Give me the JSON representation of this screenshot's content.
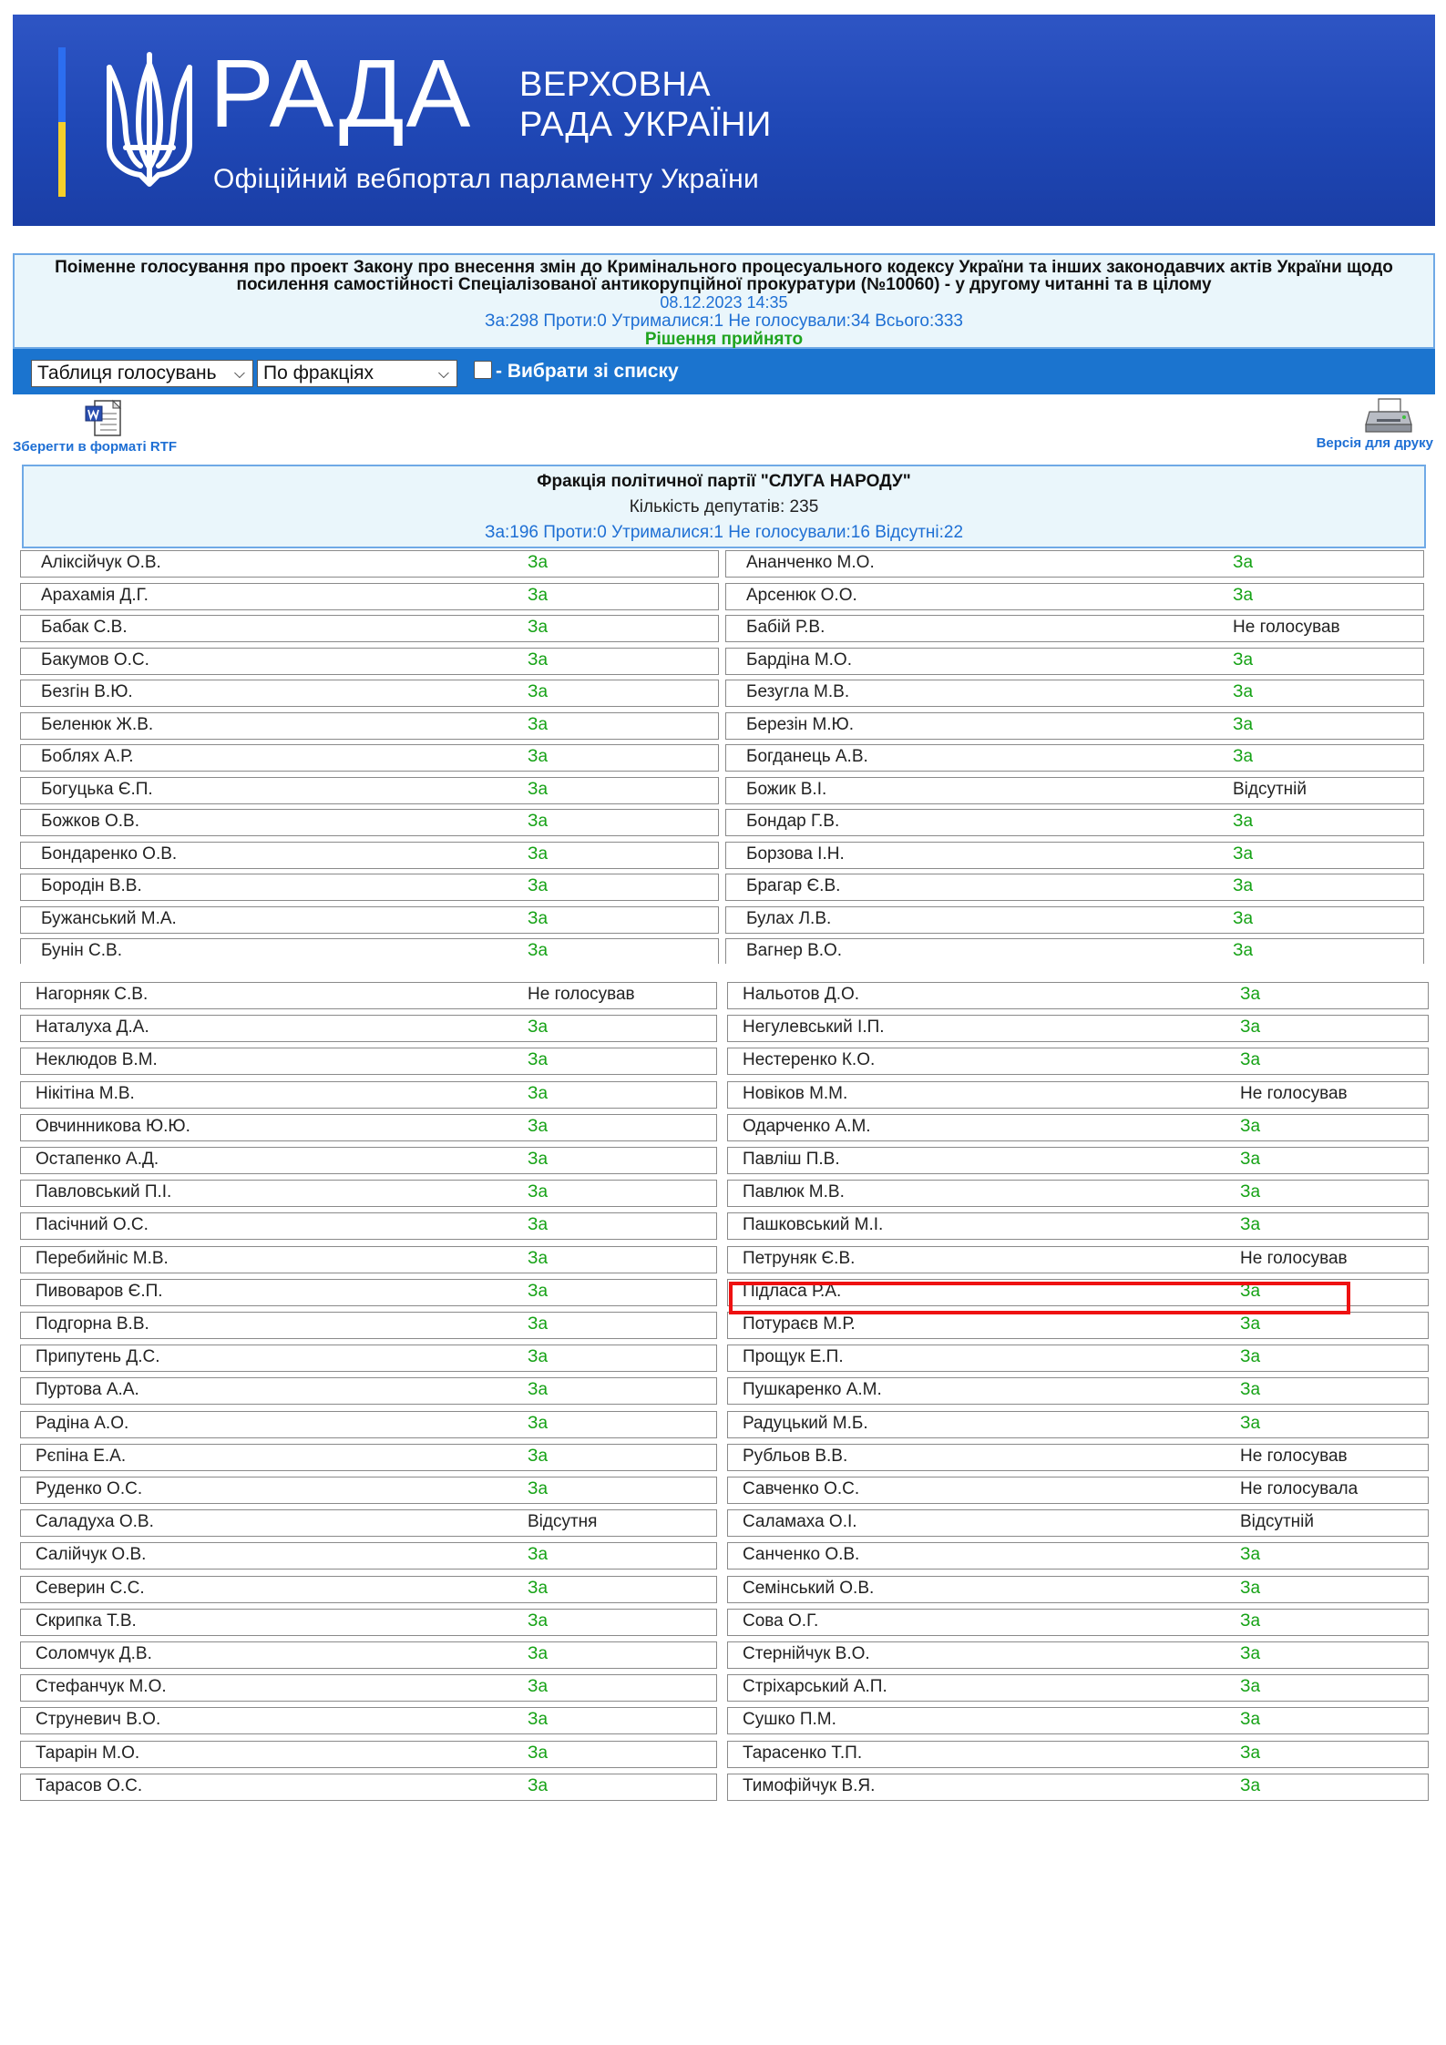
{
  "header": {
    "logo_word": "РАДА",
    "logo_line1": "ВЕРХОВНА",
    "logo_line2": "РАДА УКРАЇНИ",
    "tagline": "Офіційний вебпортал парламенту України",
    "colors": {
      "banner": "#2450bf",
      "flag_blue": "#2c6ef0",
      "flag_yellow": "#f5cf2b"
    }
  },
  "vote": {
    "title": "Поіменне голосування про проект Закону про внесення змін до Кримінального процесуального кодексу України та інших законодавчих актів України щодо посилення самостійності Спеціалізованої антикорупційної прокуратури (№10060) - у другому читанні та в цілому",
    "datetime": "08.12.2023 14:35",
    "totals": "За:298 Проти:0 Утрималися:1 Не голосували:34 Всього:333",
    "decision": "Рішення прийнято"
  },
  "toolbar": {
    "view_select": "Таблиця голосувань",
    "group_select": "По фракціях",
    "pick_label": "- Вибрати зі списку"
  },
  "links": {
    "rtf": "Зберегти в форматі RTF",
    "print": "Версія для друку"
  },
  "faction": {
    "name": "Фракція політичної партії \"СЛУГА НАРОДУ\"",
    "count": "Кількість депутатів: 235",
    "stats": "За:196 Проти:0 Утрималися:1 Не голосували:16 Відсутні:22"
  },
  "table1": [
    [
      [
        "Аліксійчук О.В.",
        "За"
      ],
      [
        "Ананченко М.О.",
        "За"
      ]
    ],
    [
      [
        "Арахамія Д.Г.",
        "За"
      ],
      [
        "Арсенюк О.О.",
        "За"
      ]
    ],
    [
      [
        "Бабак С.В.",
        "За"
      ],
      [
        "Бабій Р.В.",
        "Не голосував"
      ]
    ],
    [
      [
        "Бакумов О.С.",
        "За"
      ],
      [
        "Бардіна М.О.",
        "За"
      ]
    ],
    [
      [
        "Безгін В.Ю.",
        "За"
      ],
      [
        "Безугла М.В.",
        "За"
      ]
    ],
    [
      [
        "Беленюк Ж.В.",
        "За"
      ],
      [
        "Березін М.Ю.",
        "За"
      ]
    ],
    [
      [
        "Боблях А.Р.",
        "За"
      ],
      [
        "Богданець А.В.",
        "За"
      ]
    ],
    [
      [
        "Богуцька Є.П.",
        "За"
      ],
      [
        "Божик В.І.",
        "Відсутній"
      ]
    ],
    [
      [
        "Божков О.В.",
        "За"
      ],
      [
        "Бондар Г.В.",
        "За"
      ]
    ],
    [
      [
        "Бондаренко О.В.",
        "За"
      ],
      [
        "Борзова І.Н.",
        "За"
      ]
    ],
    [
      [
        "Бородін В.В.",
        "За"
      ],
      [
        "Брагар Є.В.",
        "За"
      ]
    ],
    [
      [
        "Бужанський М.А.",
        "За"
      ],
      [
        "Булах Л.В.",
        "За"
      ]
    ],
    [
      [
        "Бунін С.В.",
        "За"
      ],
      [
        "Вагнер В.О.",
        "За"
      ]
    ]
  ],
  "table2": [
    [
      [
        "Нагорняк С.В.",
        "Не голосував"
      ],
      [
        "Нальотов Д.О.",
        "За"
      ]
    ],
    [
      [
        "Наталуха Д.А.",
        "За"
      ],
      [
        "Негулевський І.П.",
        "За"
      ]
    ],
    [
      [
        "Неклюдов В.М.",
        "За"
      ],
      [
        "Нестеренко К.О.",
        "За"
      ]
    ],
    [
      [
        "Нікітіна М.В.",
        "За"
      ],
      [
        "Новіков М.М.",
        "Не голосував"
      ]
    ],
    [
      [
        "Овчинникова Ю.Ю.",
        "За"
      ],
      [
        "Одарченко А.М.",
        "За"
      ]
    ],
    [
      [
        "Остапенко А.Д.",
        "За"
      ],
      [
        "Павліш П.В.",
        "За"
      ]
    ],
    [
      [
        "Павловський П.І.",
        "За"
      ],
      [
        "Павлюк М.В.",
        "За"
      ]
    ],
    [
      [
        "Пасічний О.С.",
        "За"
      ],
      [
        "Пашковський М.І.",
        "За"
      ]
    ],
    [
      [
        "Перебийніс М.В.",
        "За"
      ],
      [
        "Петруняк Є.В.",
        "Не голосував"
      ]
    ],
    [
      [
        "Пивоваров Є.П.",
        "За"
      ],
      [
        "Підласа Р.А.",
        "За"
      ]
    ],
    [
      [
        "Подгорна В.В.",
        "За"
      ],
      [
        "Потураєв М.Р.",
        "За"
      ]
    ],
    [
      [
        "Припутень Д.С.",
        "За"
      ],
      [
        "Прощук Е.П.",
        "За"
      ]
    ],
    [
      [
        "Пуртова А.А.",
        "За"
      ],
      [
        "Пушкаренко А.М.",
        "За"
      ]
    ],
    [
      [
        "Радіна А.О.",
        "За"
      ],
      [
        "Радуцький М.Б.",
        "За"
      ]
    ],
    [
      [
        "Рєпіна Е.А.",
        "За"
      ],
      [
        "Рубльов В.В.",
        "Не голосував"
      ]
    ],
    [
      [
        "Руденко О.С.",
        "За"
      ],
      [
        "Савченко О.С.",
        "Не голосувала"
      ]
    ],
    [
      [
        "Саладуха О.В.",
        "Відсутня"
      ],
      [
        "Саламаха О.І.",
        "Відсутній"
      ]
    ],
    [
      [
        "Салійчук О.В.",
        "За"
      ],
      [
        "Санченко О.В.",
        "За"
      ]
    ],
    [
      [
        "Северин С.С.",
        "За"
      ],
      [
        "Семінський О.В.",
        "За"
      ]
    ],
    [
      [
        "Скрипка Т.В.",
        "За"
      ],
      [
        "Сова О.Г.",
        "За"
      ]
    ],
    [
      [
        "Соломчук Д.В.",
        "За"
      ],
      [
        "Стернійчук В.О.",
        "За"
      ]
    ],
    [
      [
        "Стефанчук М.О.",
        "За"
      ],
      [
        "Стріхарський А.П.",
        "За"
      ]
    ],
    [
      [
        "Струневич В.О.",
        "За"
      ],
      [
        "Сушко П.М.",
        "За"
      ]
    ],
    [
      [
        "Тарарін М.О.",
        "За"
      ],
      [
        "Тарасенко Т.П.",
        "За"
      ]
    ],
    [
      [
        "Тарасов О.С.",
        "За"
      ],
      [
        "Тимофійчук В.Я.",
        "За"
      ]
    ]
  ]
}
